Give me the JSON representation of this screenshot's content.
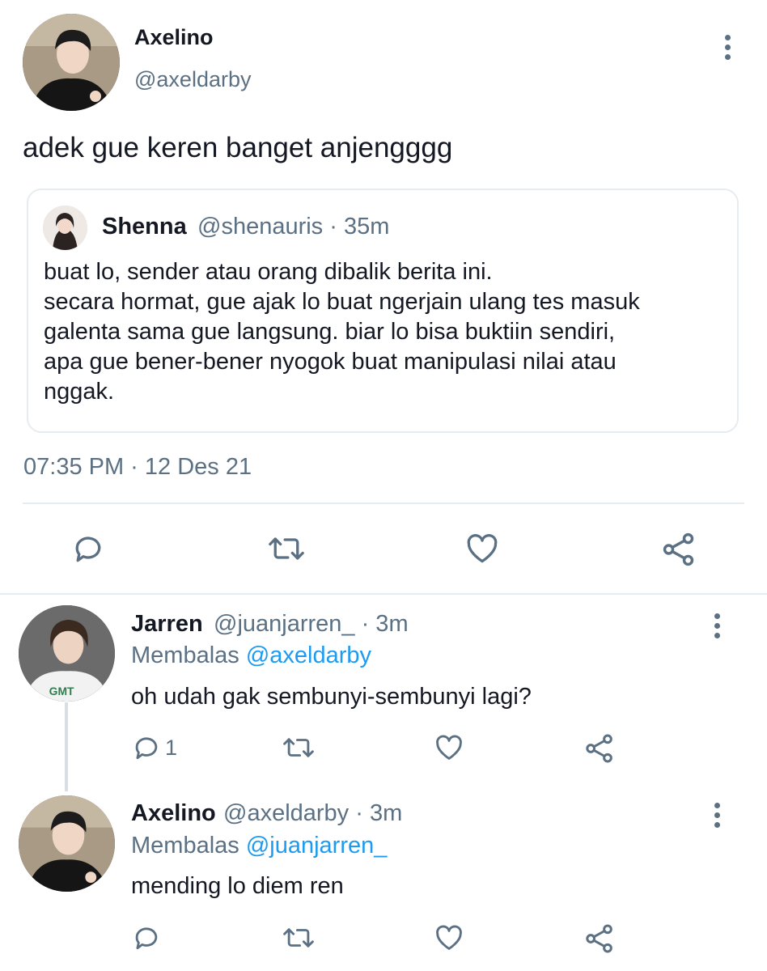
{
  "main_tweet": {
    "display_name": "Axelino",
    "handle": "@axeldarby",
    "text": "adek gue keren banget anjengggg",
    "quote": {
      "display_name": "Shenna",
      "handle_time": "@shenauris · 35m",
      "lines": [
        "buat lo, sender atau orang dibalik berita ini.",
        "secara hormat, gue ajak lo buat ngerjain ulang tes masuk",
        "galenta sama gue langsung. biar lo bisa buktiin sendiri,",
        "apa gue bener-bener nyogok buat manipulasi nilai atau",
        "nggak."
      ]
    },
    "timestamp": "07:35 PM · 12 Des 21"
  },
  "replies": [
    {
      "display_name": "Jarren",
      "handle_time": "@juanjarren_ · 3m",
      "replying_prefix": "Membalas",
      "replying_to": "@axeldarby",
      "text": "oh udah gak sembunyi-sembunyi lagi?",
      "reply_count": "1"
    },
    {
      "display_name": "Axelino",
      "handle_time": "@axeldarby · 3m",
      "replying_prefix": "Membalas",
      "replying_to": "@juanjarren_",
      "text": "mending lo diem ren",
      "reply_count": ""
    }
  ],
  "icons": {
    "more": "more-vertical-icon",
    "reply": "reply-icon",
    "retweet": "retweet-icon",
    "like": "like-icon",
    "share": "share-icon"
  },
  "colors": {
    "text": "#141823",
    "muted": "#5b7083",
    "link": "#1d9bf0",
    "divider": "#e6ecf0"
  }
}
